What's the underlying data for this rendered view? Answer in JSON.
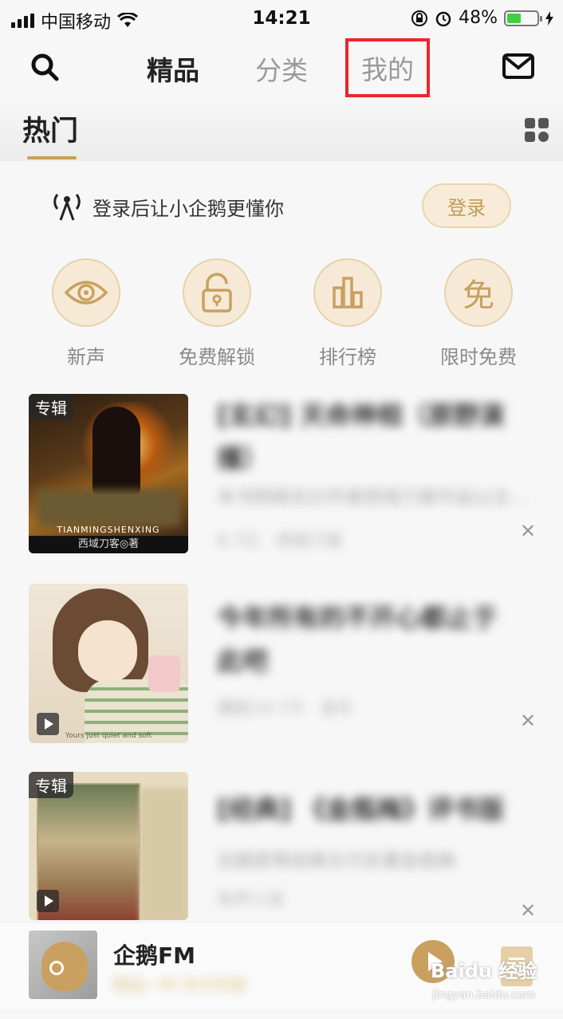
{
  "status_bar": {
    "carrier": "中国移动",
    "time": "14:21",
    "battery": "48%",
    "battery_level": 0.48
  },
  "nav": {
    "tabs": [
      {
        "label": "精品",
        "active": true
      },
      {
        "label": "分类",
        "active": false
      },
      {
        "label": "我的",
        "active": false,
        "highlighted": true
      }
    ],
    "icons": [
      "search-icon",
      "mail-icon"
    ]
  },
  "subheader": {
    "title": "热门",
    "grid_icon": "grid-icon",
    "accent": "#c8a15a"
  },
  "login": {
    "prompt": "登录后让小企鹅更懂你",
    "button": "登录",
    "icon": "signal-person-icon"
  },
  "quick_entries": [
    {
      "label": "新声",
      "icon": "eye-icon"
    },
    {
      "label": "免费解锁",
      "icon": "unlock-icon"
    },
    {
      "label": "排行榜",
      "icon": "bar-chart-icon"
    },
    {
      "label": "限时免费",
      "icon": "mian-icon",
      "glyph": "免"
    }
  ],
  "feed": [
    {
      "tag": "专辑",
      "title": "[玄幻] 天命神相（原野演播）",
      "desc": "本书网络玄幻作者西域刀客作品以主...",
      "meta": "6.7亿 · 西域刀客",
      "cover_text": "TIANMINGSHENXING",
      "cover_author": "西域刀客◎著"
    },
    {
      "tag": "",
      "title": "今年所有的不开心都止于此吧",
      "desc": "",
      "meta": "播放14.7万 · 音乐",
      "cover_text": "Yours just quiet and soft"
    },
    {
      "tag": "专辑",
      "title": "[经典] 《金瓶梅》评书版",
      "desc": "白鹿原等经典古代名著金瓶梅",
      "meta": "有声小说"
    }
  ],
  "player": {
    "title": "企鹅FM",
    "subtitle": "精品一听 你才知道"
  },
  "watermark": {
    "brand": "Baidu 经验",
    "url": "jingyan.baidu.com"
  }
}
